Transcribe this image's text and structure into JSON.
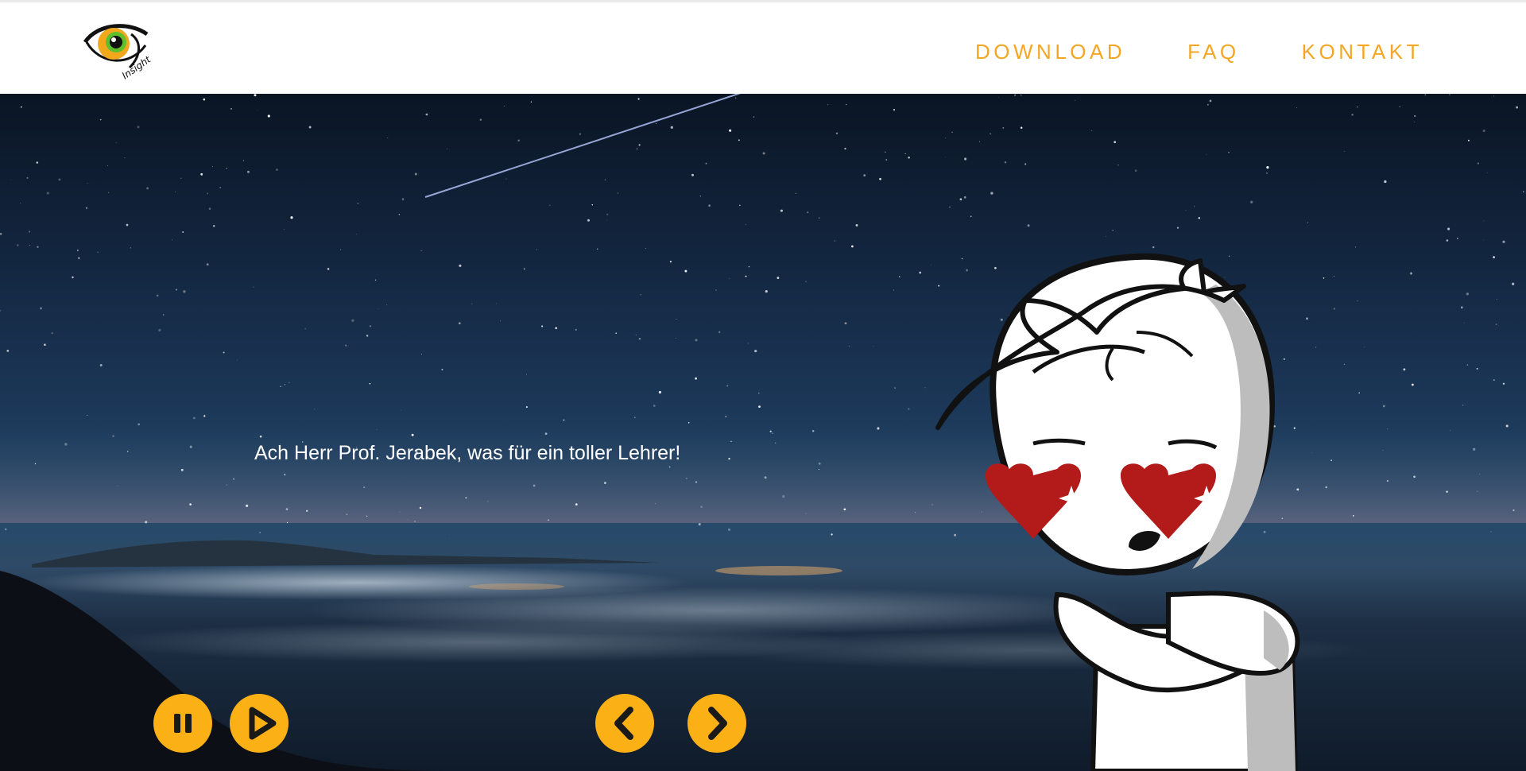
{
  "header": {
    "logo": {
      "icon": "eye-logo-icon",
      "text": "Insight"
    },
    "nav": [
      {
        "label": "DOWNLOAD"
      },
      {
        "label": "FAQ"
      },
      {
        "label": "KONTAKT"
      }
    ],
    "nav_color": "#f5a623"
  },
  "hero": {
    "caption": "Ach Herr Prof. Jerabek, was für ein toller Lehrer!",
    "character": {
      "icon": "cartoon-character-heart-eyes-icon"
    },
    "controls": {
      "pause": {
        "icon": "pause-icon"
      },
      "play": {
        "icon": "play-icon"
      },
      "prev": {
        "icon": "chevron-left-icon"
      },
      "next": {
        "icon": "chevron-right-icon"
      },
      "color": "#fbb016"
    }
  }
}
